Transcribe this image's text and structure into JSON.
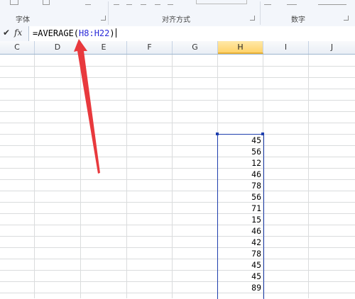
{
  "ribbon": {
    "groups": [
      {
        "label": "字体"
      },
      {
        "label": "对齐方式"
      },
      {
        "label": "数字"
      }
    ]
  },
  "formula_bar": {
    "check_symbol": "✔",
    "fx_label": "fx",
    "formula_prefix": "=AVERAGE(",
    "formula_ref": "H8:H22",
    "formula_suffix": ")"
  },
  "columns": [
    "C",
    "D",
    "E",
    "F",
    "G",
    "H",
    "I",
    "J"
  ],
  "selected_column": "H",
  "cells": [
    "45",
    "56",
    "12",
    "46",
    "78",
    "56",
    "71",
    "15",
    "46",
    "42",
    "78",
    "45",
    "45",
    "89"
  ],
  "colors": {
    "selection_border": "#1f3fae",
    "arrow": "#e8393d",
    "selected_header": "#ffd36b"
  }
}
